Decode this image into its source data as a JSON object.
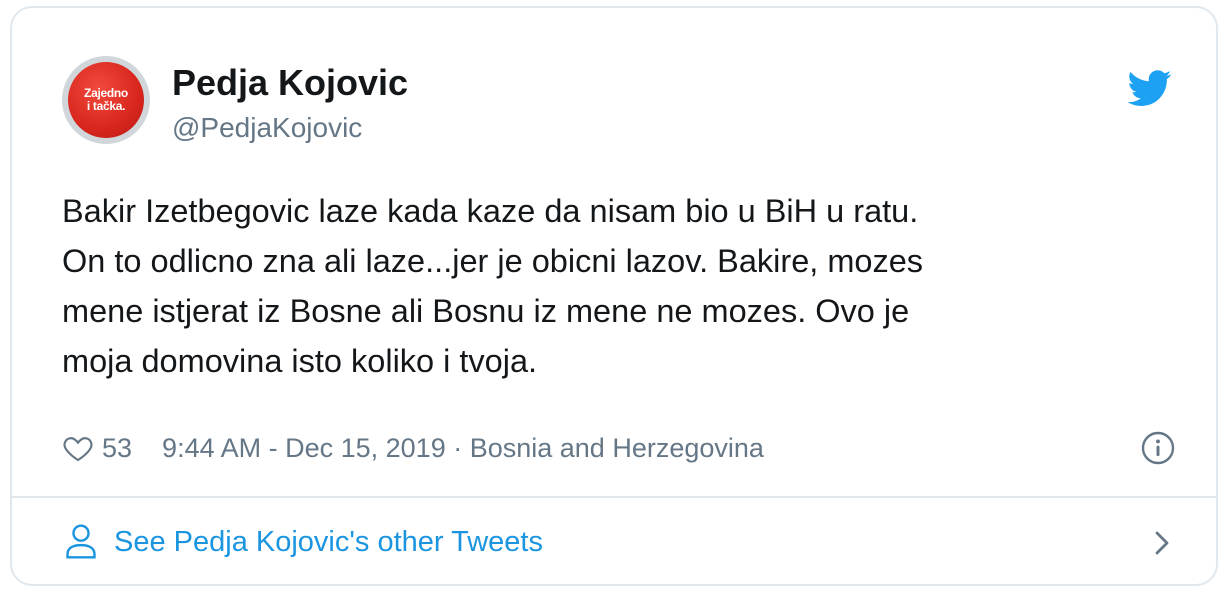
{
  "author": {
    "name": "Pedja Kojovic",
    "handle": "@PedjaKojovic",
    "avatar_text": [
      "Zajedno",
      "i tačka."
    ]
  },
  "tweet": {
    "lines": [
      "Bakir Izetbegovic laze kada kaze da nisam bio u BiH u ratu.",
      "On to odlicno zna ali laze...jer je obicni lazov. Bakire, mozes",
      "mene istjerat iz Bosne ali Bosnu iz mene ne mozes. Ovo je",
      "moja domovina isto koliko i tvoja."
    ]
  },
  "meta": {
    "likes": "53",
    "timestamp": "9:44 AM - Dec 15, 2019 · Bosnia and Herzegovina"
  },
  "footer": {
    "link_label": "See Pedja Kojovic's other Tweets"
  },
  "icons": {
    "bird": "twitter-bird-icon",
    "heart": "heart-icon",
    "info": "info-icon",
    "person": "person-icon",
    "chevron": "chevron-right-icon"
  },
  "colors": {
    "brand": "#1da1f2",
    "link": "#1b95e0",
    "muted": "#657786",
    "text": "#14171a",
    "border": "#e1e8ed",
    "avatar_red": "#d8261d"
  }
}
